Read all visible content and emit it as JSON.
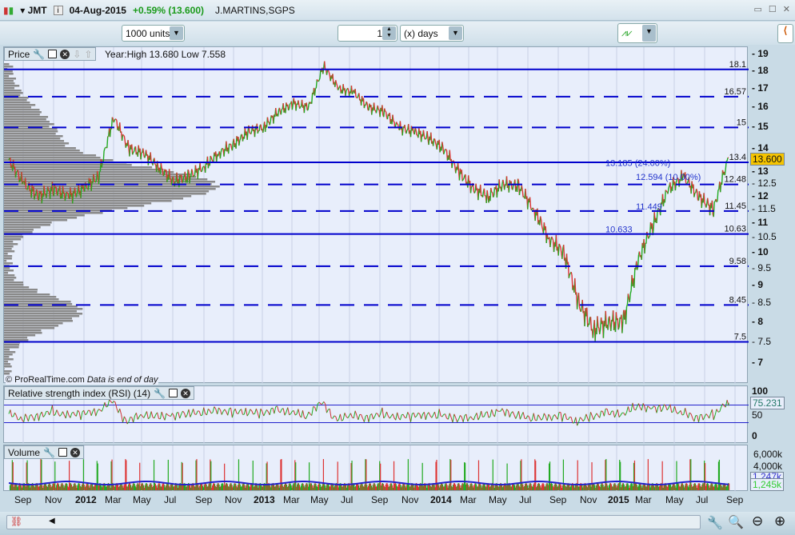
{
  "header": {
    "ticker": "JMT",
    "date": "04-Aug-2015",
    "change": "+0.59% (13.600)",
    "name": "J.MARTINS,SGPS"
  },
  "toolbar": {
    "units": "1000 units",
    "period_value": "1",
    "period_unit": "(x) days"
  },
  "price_panel": {
    "label": "Price",
    "info": "Year:High 13.680 Low 7.558",
    "copyright": "© ProRealTime.com",
    "note": "Data is end of day",
    "last_price": "13.600",
    "level_labels": [
      "18.1",
      "16.57",
      "15",
      "13.4",
      "12.48",
      "11.45",
      "10.63",
      "9.58",
      "8.45",
      "7.5"
    ],
    "fib_labels": [
      "13.185 (24.00%)",
      "12.594 (10.00%)",
      "11.449",
      "10.633"
    ],
    "axis_ticks": [
      "19",
      "18",
      "17",
      "16",
      "15",
      "14",
      "13",
      "12.5",
      "12",
      "11.5",
      "11",
      "10.5",
      "10",
      "9.5",
      "9",
      "8.5",
      "8",
      "7.5",
      "7"
    ]
  },
  "rsi_panel": {
    "label": "Relative strength index (RSI) (14)",
    "value": "75.231",
    "ticks": [
      "100",
      "50",
      "0"
    ]
  },
  "volume_panel": {
    "label": "Volume",
    "ticks": [
      "6,000k",
      "4,000k"
    ],
    "avg": "1,247k",
    "value": "1,245k"
  },
  "x_axis": [
    "Sep",
    "Nov",
    "2012",
    "Mar",
    "May",
    "Jul",
    "Sep",
    "Nov",
    "2013",
    "Mar",
    "May",
    "Jul",
    "Sep",
    "Nov",
    "2014",
    "Mar",
    "May",
    "Jul",
    "Sep",
    "Nov",
    "2015",
    "Mar",
    "May",
    "Jul",
    "Sep"
  ],
  "colors": {
    "up": "#22aa22",
    "down": "#dd3333",
    "level": "#0000cc",
    "panel": "#e8eefb"
  },
  "chart_data": {
    "type": "line",
    "title": "JMT daily price (approx. monthly)",
    "x": [
      "2011-08",
      "2011-09",
      "2011-10",
      "2011-11",
      "2011-12",
      "2012-01",
      "2012-02",
      "2012-03",
      "2012-04",
      "2012-05",
      "2012-06",
      "2012-07",
      "2012-08",
      "2012-09",
      "2012-10",
      "2012-11",
      "2012-12",
      "2013-01",
      "2013-02",
      "2013-03",
      "2013-04",
      "2013-05",
      "2013-06",
      "2013-07",
      "2013-08",
      "2013-09",
      "2013-10",
      "2013-11",
      "2013-12",
      "2014-01",
      "2014-02",
      "2014-03",
      "2014-04",
      "2014-05",
      "2014-06",
      "2014-07",
      "2014-08",
      "2014-09",
      "2014-10",
      "2014-11",
      "2014-12",
      "2015-01",
      "2015-02",
      "2015-03",
      "2015-04",
      "2015-05",
      "2015-06",
      "2015-07",
      "2015-08"
    ],
    "y": [
      13.5,
      12.5,
      12.0,
      12.3,
      12.0,
      12.3,
      12.8,
      15.5,
      14.0,
      13.8,
      13.2,
      12.6,
      12.8,
      13.2,
      13.8,
      14.2,
      14.8,
      15.0,
      15.8,
      16.2,
      16.0,
      18.3,
      17.0,
      16.8,
      16.0,
      15.8,
      15.0,
      14.8,
      14.5,
      14.0,
      13.0,
      12.3,
      12.0,
      12.5,
      12.4,
      11.5,
      10.5,
      10.0,
      8.5,
      7.8,
      8.0,
      8.0,
      9.8,
      11.0,
      12.3,
      12.8,
      12.0,
      11.5,
      13.6
    ],
    "ylim": [
      7,
      19
    ],
    "scale": "log",
    "levels": [
      {
        "v": 18.1,
        "style": "solid"
      },
      {
        "v": 16.57,
        "style": "dashed"
      },
      {
        "v": 15,
        "style": "dashed"
      },
      {
        "v": 13.4,
        "style": "solid"
      },
      {
        "v": 12.48,
        "style": "dashed"
      },
      {
        "v": 11.45,
        "style": "dashed"
      },
      {
        "v": 10.63,
        "style": "solid"
      },
      {
        "v": 9.58,
        "style": "dashed"
      },
      {
        "v": 8.45,
        "style": "dashed"
      },
      {
        "v": 7.5,
        "style": "solid"
      }
    ]
  }
}
